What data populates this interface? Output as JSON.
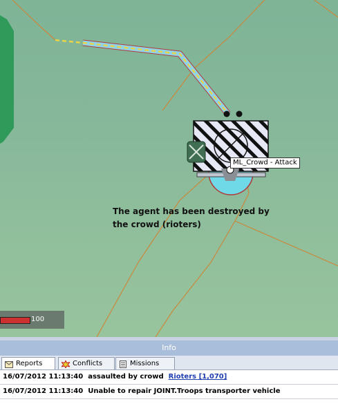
{
  "map": {
    "unit_tooltip": "ML_Crowd - Attack",
    "caption_text": "The agent has been destroyed by the crowd (rioters)",
    "health_value": "100",
    "health_fraction": 0.42
  },
  "info_panel": {
    "title": "Info",
    "tabs": [
      {
        "label": "Reports",
        "icon": "envelope-icon"
      },
      {
        "label": "Conflicts",
        "icon": "explosion-icon"
      },
      {
        "label": "Missions",
        "icon": "document-icon"
      }
    ],
    "rows": [
      {
        "time": "16/07/2012 11:13:40",
        "message": "assaulted by crowd",
        "link": "Rioters [1,070]"
      },
      {
        "time": "16/07/2012 11:13:40",
        "message": "Unable to repair JOINT.Troops transporter vehicle",
        "link": ""
      }
    ]
  },
  "colors": {
    "terrain_green": "#86b79a",
    "forest": "#2f9a5a",
    "route_blue": "#8fd3e8",
    "route_yellow": "#e8d44a",
    "road": "#c9883c",
    "info_header": "#a9bedb"
  }
}
